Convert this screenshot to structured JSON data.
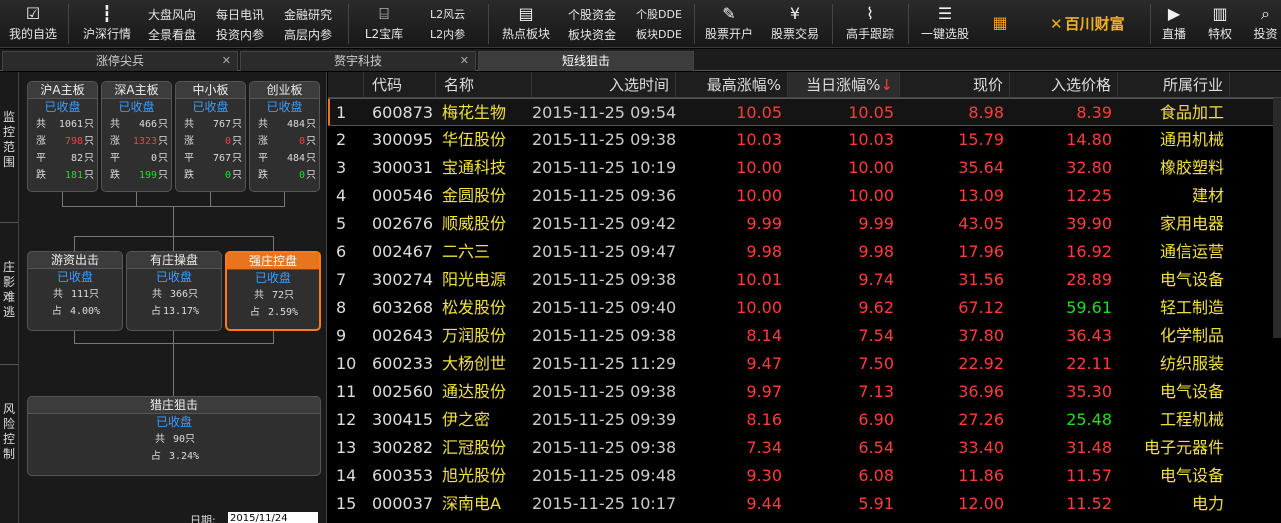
{
  "toolbar": {
    "my_select": "我的自选",
    "hs_quotes": "沪深行情",
    "pair1": [
      "大盘风向",
      "全景看盘"
    ],
    "pair2": [
      "每日电讯",
      "投资内参"
    ],
    "pair3": [
      "金融研究",
      "高层内参"
    ],
    "l2_treasure": "L2宝库",
    "pair4": [
      "L2风云",
      "L2内参"
    ],
    "hot_sectors": "热点板块",
    "pair5": [
      "个股资金",
      "板块资金"
    ],
    "pair6": [
      "个股DDE",
      "板块DDE"
    ],
    "open_account": "股票开户",
    "stock_trade": "股票交易",
    "master_track": "高手跟踪",
    "one_click": "一键选股",
    "logo_text": "百川财富",
    "live": "直播",
    "privilege": "特权",
    "invest": "投资"
  },
  "tabs": [
    {
      "label": "涨停尖兵"
    },
    {
      "label": "赘宇科技"
    },
    {
      "label": "短线狙击"
    }
  ],
  "left_panel": {
    "labels": {
      "monitor": "监控范围",
      "escape": "庄影难逃",
      "risk": "风险控制"
    },
    "boards": [
      {
        "title": "沪A主板",
        "status": "已收盘",
        "total": "1061",
        "up": "798",
        "flat": "82",
        "down": "181"
      },
      {
        "title": "深A主板",
        "status": "已收盘",
        "total": "466",
        "up": "1323",
        "flat": "0",
        "down": "199"
      },
      {
        "title": "中小板",
        "status": "已收盘",
        "total": "767",
        "up": "0",
        "flat": "767",
        "down": "0"
      },
      {
        "title": "创业板",
        "status": "已收盘",
        "total": "484",
        "up": "0",
        "flat": "484",
        "down": "0"
      }
    ],
    "row_keys": {
      "total": "共",
      "up": "涨",
      "flat": "平",
      "down": "跌",
      "unit": "只",
      "share": "占"
    },
    "mid_boards": [
      {
        "title": "游资出击",
        "status": "已收盘",
        "total": "111只",
        "share": "4.00%"
      },
      {
        "title": "有庄操盘",
        "status": "已收盘",
        "total": "366只",
        "share": "13.17%"
      },
      {
        "title": "强庄控盘",
        "status": "已收盘",
        "total": "72只",
        "share": "2.59%"
      }
    ],
    "hunt": {
      "title": "猎庄狙击",
      "status": "已收盘",
      "total": "90只",
      "share": "3.24%"
    },
    "date_label": "日期:",
    "date_value": "2015/11/24"
  },
  "table": {
    "headers": {
      "code": "代码",
      "name": "名称",
      "time": "入选时间",
      "max_rise": "最高涨幅%",
      "day_rise": "当日涨幅%",
      "sort_arrow": "↓",
      "price": "现价",
      "entry_price": "入选价格",
      "industry": "所属行业"
    },
    "rows": [
      {
        "idx": "1",
        "code": "600873",
        "name": "梅花生物",
        "time": "2015-11-25 09:54",
        "max": "10.05",
        "day": "10.05",
        "price": "8.98",
        "entry": "8.39",
        "industry": "食品加工",
        "entry_color": "red"
      },
      {
        "idx": "2",
        "code": "300095",
        "name": "华伍股份",
        "time": "2015-11-25 09:38",
        "max": "10.03",
        "day": "10.03",
        "price": "15.79",
        "entry": "14.80",
        "industry": "通用机械",
        "entry_color": "red"
      },
      {
        "idx": "3",
        "code": "300031",
        "name": "宝通科技",
        "time": "2015-11-25 10:19",
        "max": "10.00",
        "day": "10.00",
        "price": "35.64",
        "entry": "32.80",
        "industry": "橡胶塑料",
        "entry_color": "red"
      },
      {
        "idx": "4",
        "code": "000546",
        "name": "金圆股份",
        "time": "2015-11-25 09:36",
        "max": "10.00",
        "day": "10.00",
        "price": "13.09",
        "entry": "12.25",
        "industry": "建材",
        "entry_color": "red"
      },
      {
        "idx": "5",
        "code": "002676",
        "name": "顺威股份",
        "time": "2015-11-25 09:42",
        "max": "9.99",
        "day": "9.99",
        "price": "43.05",
        "entry": "39.90",
        "industry": "家用电器",
        "entry_color": "red"
      },
      {
        "idx": "6",
        "code": "002467",
        "name": "二六三",
        "time": "2015-11-25 09:47",
        "max": "9.98",
        "day": "9.98",
        "price": "17.96",
        "entry": "16.92",
        "industry": "通信运营",
        "entry_color": "red"
      },
      {
        "idx": "7",
        "code": "300274",
        "name": "阳光电源",
        "time": "2015-11-25 09:38",
        "max": "10.01",
        "day": "9.74",
        "price": "31.56",
        "entry": "28.89",
        "industry": "电气设备",
        "entry_color": "red"
      },
      {
        "idx": "8",
        "code": "603268",
        "name": "松发股份",
        "time": "2015-11-25 09:40",
        "max": "10.00",
        "day": "9.62",
        "price": "67.12",
        "entry": "59.61",
        "industry": "轻工制造",
        "entry_color": "green"
      },
      {
        "idx": "9",
        "code": "002643",
        "name": "万润股份",
        "time": "2015-11-25 09:38",
        "max": "8.14",
        "day": "7.54",
        "price": "37.80",
        "entry": "36.43",
        "industry": "化学制品",
        "entry_color": "red"
      },
      {
        "idx": "10",
        "code": "600233",
        "name": "大杨创世",
        "time": "2015-11-25 11:29",
        "max": "9.47",
        "day": "7.50",
        "price": "22.92",
        "entry": "22.11",
        "industry": "纺织服装",
        "entry_color": "red"
      },
      {
        "idx": "11",
        "code": "002560",
        "name": "通达股份",
        "time": "2015-11-25 09:38",
        "max": "9.97",
        "day": "7.13",
        "price": "36.96",
        "entry": "35.30",
        "industry": "电气设备",
        "entry_color": "red"
      },
      {
        "idx": "12",
        "code": "300415",
        "name": "伊之密",
        "time": "2015-11-25 09:39",
        "max": "8.16",
        "day": "6.90",
        "price": "27.26",
        "entry": "25.48",
        "industry": "工程机械",
        "entry_color": "green"
      },
      {
        "idx": "13",
        "code": "300282",
        "name": "汇冠股份",
        "time": "2015-11-25 09:38",
        "max": "7.34",
        "day": "6.54",
        "price": "33.40",
        "entry": "31.48",
        "industry": "电子元器件",
        "entry_color": "red"
      },
      {
        "idx": "14",
        "code": "600353",
        "name": "旭光股份",
        "time": "2015-11-25 09:48",
        "max": "9.30",
        "day": "6.08",
        "price": "11.86",
        "entry": "11.57",
        "industry": "电气设备",
        "entry_color": "red"
      },
      {
        "idx": "15",
        "code": "000037",
        "name": "深南电A",
        "time": "2015-11-25 10:17",
        "max": "9.44",
        "day": "5.91",
        "price": "12.00",
        "entry": "11.52",
        "industry": "电力",
        "entry_color": "red"
      }
    ]
  },
  "colors": {
    "up": "#ff3b3b",
    "down": "#22dd22",
    "name": "#f0e040",
    "accent": "#e8741e",
    "status": "#3b9cff"
  },
  "icons": [
    "checkbox-icon",
    "candlestick-icon",
    "gift-icon",
    "newspaper-icon",
    "account-icon",
    "yen-icon",
    "line-chart-icon",
    "list-icon",
    "grid-icon",
    "video-icon",
    "bar-chart-icon"
  ]
}
